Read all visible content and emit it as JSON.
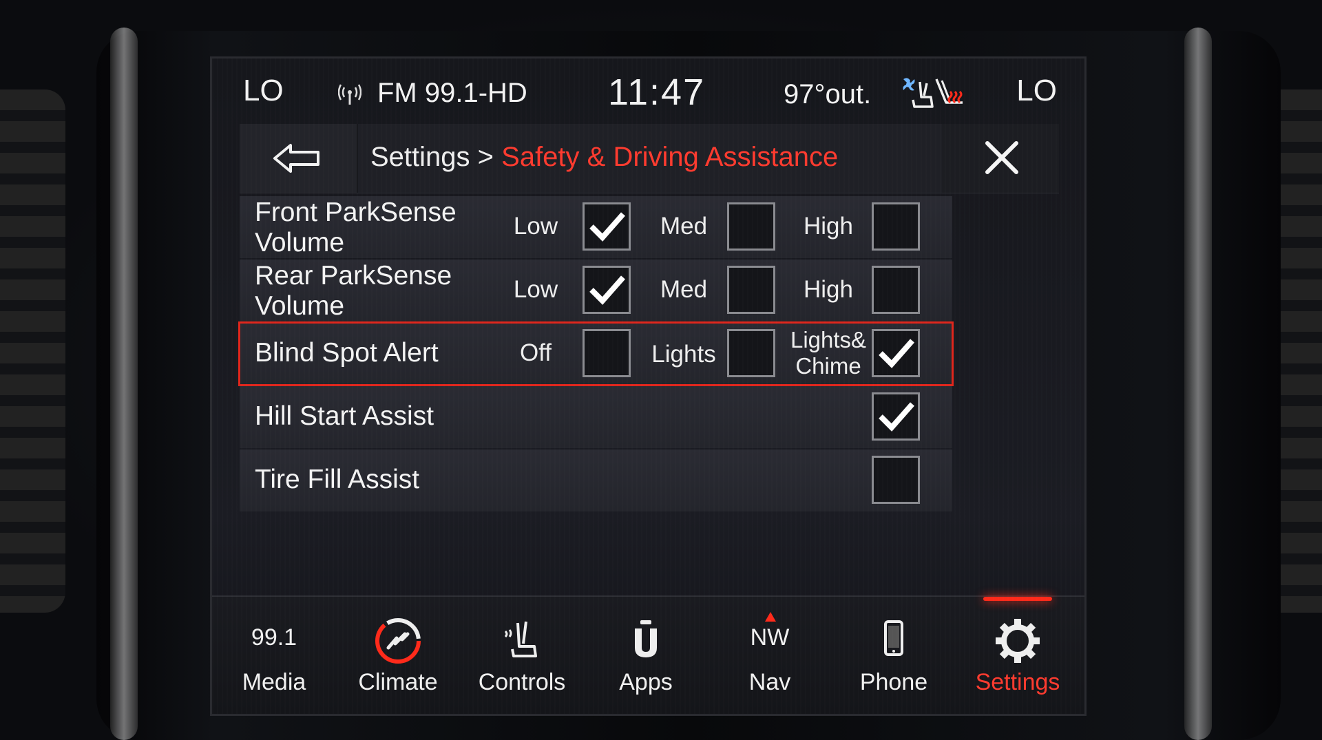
{
  "status_bar": {
    "left_temp": "LO",
    "radio": "FM 99.1-HD",
    "time": "11:47",
    "outside_temp": "97°out.",
    "right_temp": "LO"
  },
  "header": {
    "crumb_root": "Settings >",
    "crumb_active": "Safety & Driving Assistance"
  },
  "settings": {
    "front_parksense": {
      "label_line1": "Front ParkSense",
      "label_line2": "Volume",
      "opt1": "Low",
      "opt2": "Med",
      "opt3": "High",
      "selected": "Low"
    },
    "rear_parksense": {
      "label_line1": "Rear ParkSense",
      "label_line2": "Volume",
      "opt1": "Low",
      "opt2": "Med",
      "opt3": "High",
      "selected": "Low"
    },
    "blind_spot": {
      "label": "Blind Spot Alert",
      "opt1": "Off",
      "opt2": "Lights",
      "opt3_line1": "Lights&",
      "opt3_line2": "Chime",
      "selected": "Lights& Chime"
    },
    "hill_start": {
      "label": "Hill Start Assist",
      "checked": true
    },
    "tire_fill": {
      "label": "Tire Fill Assist",
      "checked": false
    }
  },
  "bottom_nav": {
    "media_value": "99.1",
    "media": "Media",
    "climate": "Climate",
    "controls": "Controls",
    "apps": "Apps",
    "nav_heading": "NW",
    "nav": "Nav",
    "phone": "Phone",
    "settings": "Settings",
    "active": "Settings"
  },
  "colors": {
    "accent": "#ff3b2f",
    "selection_outline": "#e0261c"
  }
}
